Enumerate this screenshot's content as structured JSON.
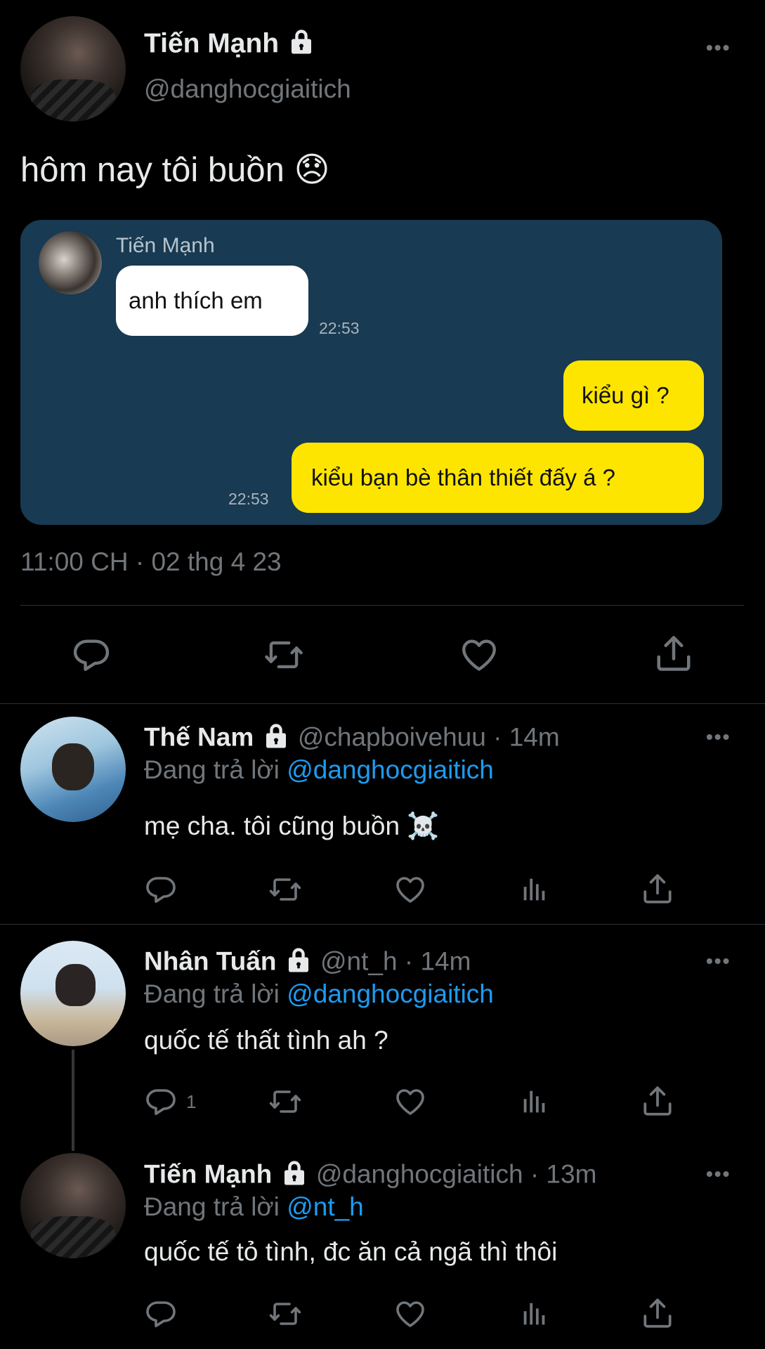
{
  "main_tweet": {
    "author_name": "Tiến Mạnh",
    "handle": "@danghocgiaitich",
    "text": "hôm nay tôi buồn 😞",
    "timestamp": "11:00 CH · 02 thg 4 23",
    "chat_image": {
      "sender": "Tiến Mạnh",
      "messages": [
        {
          "text": "anh thích em",
          "time": "22:53",
          "side": "left"
        },
        {
          "text": "kiểu gì ?",
          "time": "",
          "side": "right"
        },
        {
          "text": "kiểu bạn bè thân thiết đấy á ?",
          "time": "22:53",
          "side": "right"
        }
      ]
    }
  },
  "replies": [
    {
      "author_name": "Thế Nam",
      "handle": "@chapboivehuu",
      "age": "· 14m",
      "replying_prefix": "Đang trả lời",
      "replying_to": "@danghocgiaitich",
      "text": "mẹ cha. tôi cũng buồn ☠️",
      "reply_count": ""
    },
    {
      "author_name": "Nhân Tuấn",
      "handle": "@nt_h",
      "age": "· 14m",
      "replying_prefix": "Đang trả lời",
      "replying_to": "@danghocgiaitich",
      "text": "quốc tế thất tình ah ?",
      "reply_count": "1"
    },
    {
      "author_name": "Tiến Mạnh",
      "handle": "@danghocgiaitich",
      "age": "· 13m",
      "replying_prefix": "Đang trả lời",
      "replying_to": "@nt_h",
      "text": "quốc tế tỏ tình, đc ăn cả ngã thì thôi",
      "reply_count": ""
    }
  ],
  "icons": [
    "reply-icon",
    "retweet-icon",
    "like-icon",
    "views-icon",
    "share-icon",
    "lock-icon",
    "more-icon"
  ],
  "colors": {
    "background": "#000000",
    "link": "#1d9bf0",
    "muted": "#71767b",
    "chat_card": "#183a52",
    "bubble_yellow": "#fee500"
  }
}
